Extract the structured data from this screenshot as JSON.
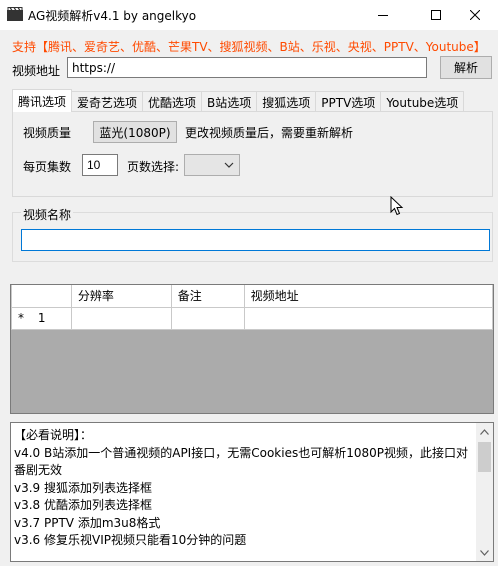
{
  "window": {
    "title": "AG视频解析v4.1 by angelkyo"
  },
  "support_text": "支持【腾讯、爱奇艺、优酷、芒果TV、搜狐视频、B站、乐视、央视、PPTV、Youtube】",
  "url": {
    "label": "视频地址",
    "value": "https://"
  },
  "parse_button": "解析",
  "tabs": [
    "腾讯选项",
    "爱奇艺选项",
    "优酷选项",
    "B站选项",
    "搜狐选项",
    "PPTV选项",
    "Youtube选项"
  ],
  "active_tab": 0,
  "tab_panel": {
    "quality_label": "视频质量",
    "quality_value": "蓝光(1080P)",
    "quality_hint": "更改视频质量后，需要重新解析",
    "episodes_label": "每页集数",
    "episodes_value": "10",
    "page_label": "页数选择:"
  },
  "video_name": {
    "label": "视频名称",
    "value": ""
  },
  "grid": {
    "columns": [
      "分辨率",
      "备注",
      "视频地址"
    ],
    "rows": [
      {
        "marker": "*",
        "index": "1"
      }
    ]
  },
  "log": {
    "lines": [
      "【必看说明】：",
      "  v4.0 B站添加一个普通视频的API接口，无需Cookies也可解析1080P视频，此接口对番剧无效",
      "  v3.9 搜狐添加列表选择框",
      "  v3.8 优酷添加列表选择框",
      "  v3.7 PPTV 添加m3u8格式",
      "  v3.6 修复乐视VIP视频只能看10分钟的问题"
    ]
  },
  "colors": {
    "accent_text": "#ff4a00",
    "focus_border": "#0078d7"
  }
}
